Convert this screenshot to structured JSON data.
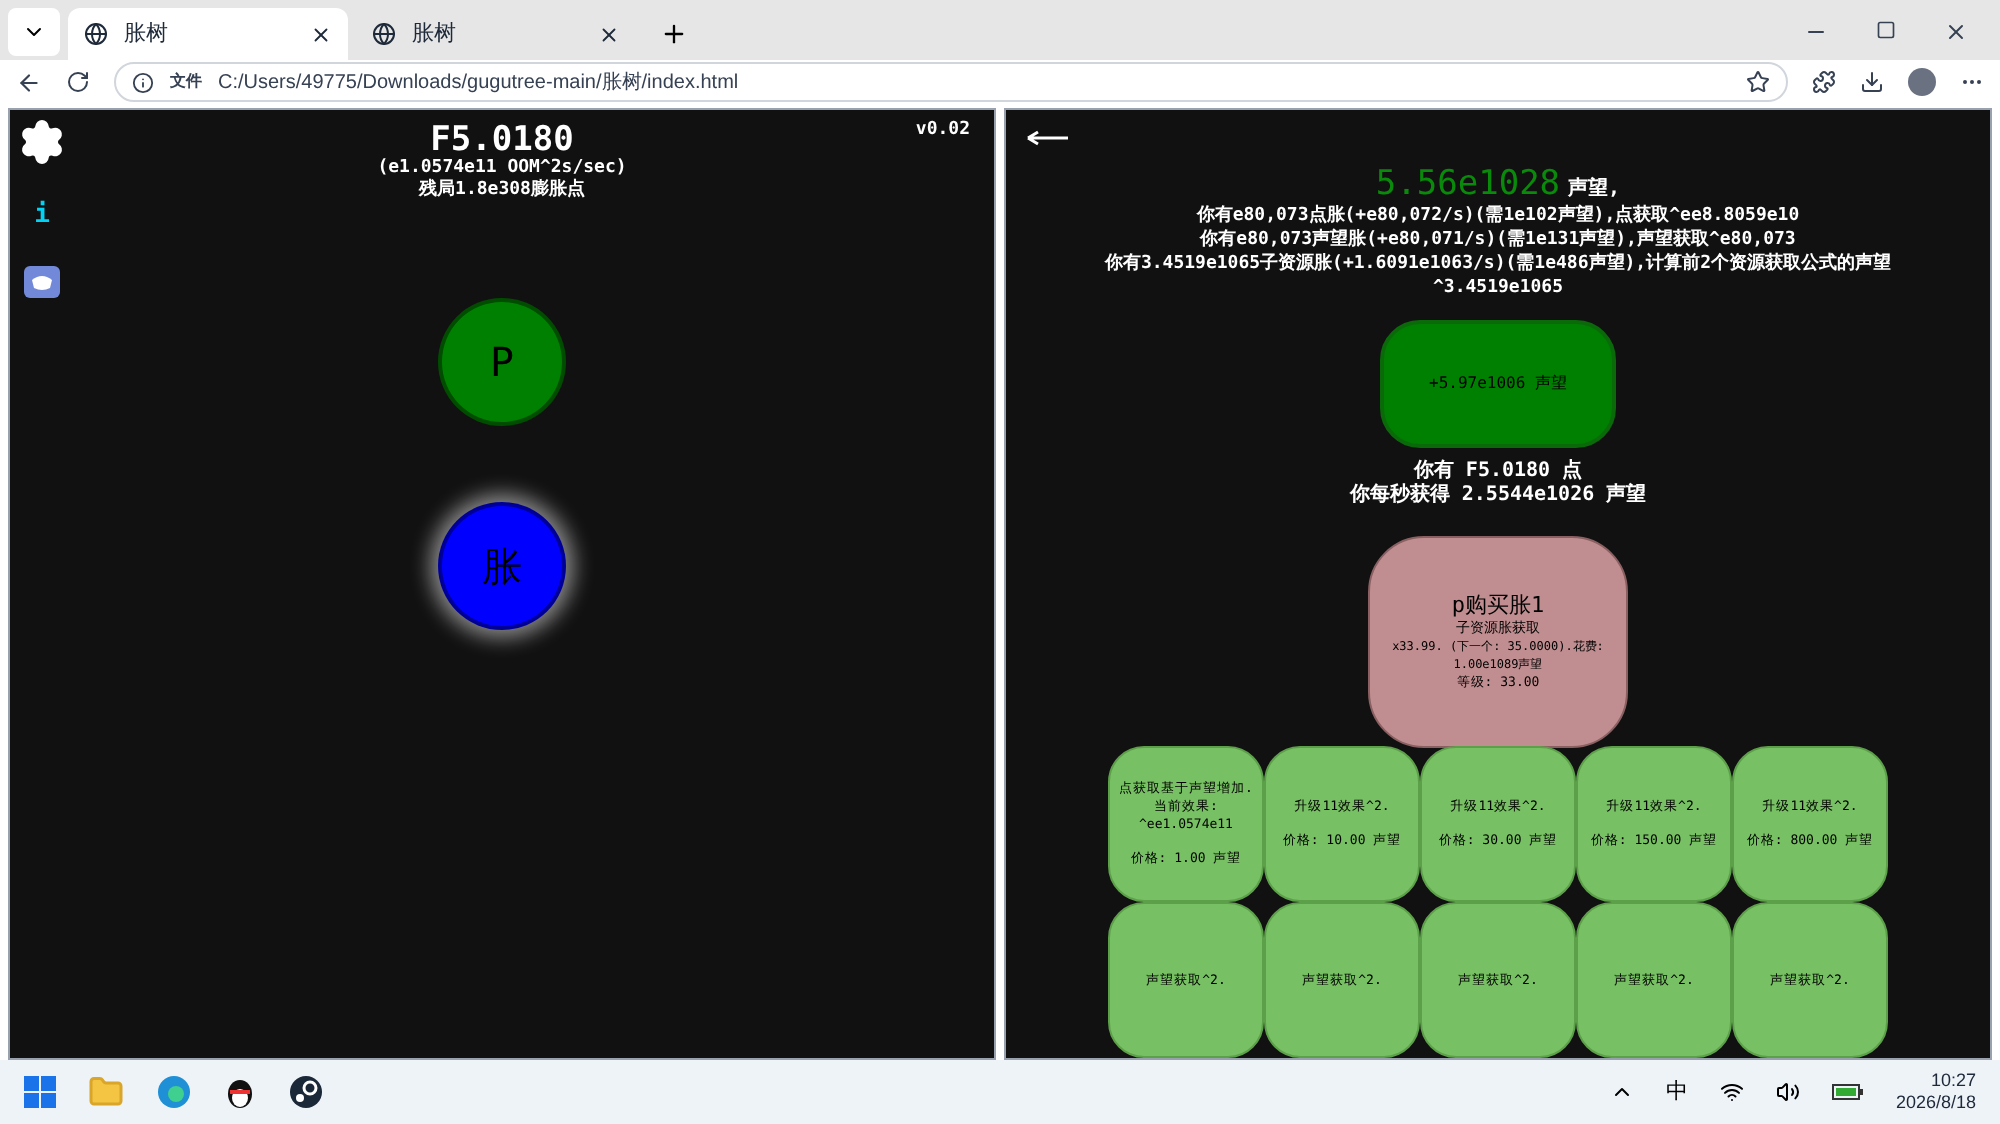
{
  "browser": {
    "tabs": [
      {
        "title": "胀树",
        "selected": true
      },
      {
        "title": "胀树",
        "selected": false
      }
    ],
    "address": {
      "scheme_label": "文件",
      "url": "C:/Users/49775/Downloads/gugutree-main/胀树/index.html"
    }
  },
  "left_panel": {
    "info_label": "i",
    "version": "v0.02",
    "points": "F5.0180",
    "rate": "(e1.0574e11 OOM^2s/sec)",
    "endgame": "残局1.8e308膨胀点",
    "layer_buttons": [
      {
        "label": "P",
        "color": "#008000",
        "glow": false
      },
      {
        "label": "胀",
        "color": "#0000ff",
        "glow": true
      }
    ]
  },
  "right_panel": {
    "prestige_amount": "5.56e1028",
    "prestige_unit": "声望,",
    "lines": [
      "你有e80,073点胀(+e80,072/s)(需1e102声望),点获取^ee8.8059e10",
      "你有e80,073声望胀(+e80,071/s)(需1e131声望),声望获取^e80,073",
      "你有3.4519e1065子资源胀(+1.6091e1063/s)(需1e486声望),计算前2个资源获取公式的声望",
      "^3.4519e1065"
    ],
    "reset_button": "+5.97e1006 声望",
    "stats": [
      "你有 F5.0180 点",
      "你每秒获得 2.5544e1026 声望"
    ],
    "buyable": {
      "title": "p购买胀1",
      "subtitle": "子资源胀获取",
      "effect": "x33.99. (下一个: 35.0000).花费: 1.00e1089声望",
      "level": "等级: 33.00"
    },
    "upgrades": [
      {
        "lines": [
          "点获取基于声望增加.",
          "当前效果:",
          "^ee1.0574e11"
        ],
        "price": "价格: 1.00 声望"
      },
      {
        "lines": [
          "升级11效果^2."
        ],
        "price": "价格: 10.00 声望"
      },
      {
        "lines": [
          "升级11效果^2."
        ],
        "price": "价格: 30.00 声望"
      },
      {
        "lines": [
          "升级11效果^2."
        ],
        "price": "价格: 150.00 声望"
      },
      {
        "lines": [
          "升级11效果^2."
        ],
        "price": "价格: 800.00 声望"
      },
      {
        "lines": [
          "声望获取^2."
        ]
      },
      {
        "lines": [
          "声望获取^2."
        ]
      },
      {
        "lines": [
          "声望获取^2."
        ]
      },
      {
        "lines": [
          "声望获取^2."
        ]
      },
      {
        "lines": [
          "声望获取^2."
        ]
      }
    ]
  },
  "taskbar": {
    "ime": "中",
    "time": "10:27",
    "date": "2026/8/18"
  }
}
